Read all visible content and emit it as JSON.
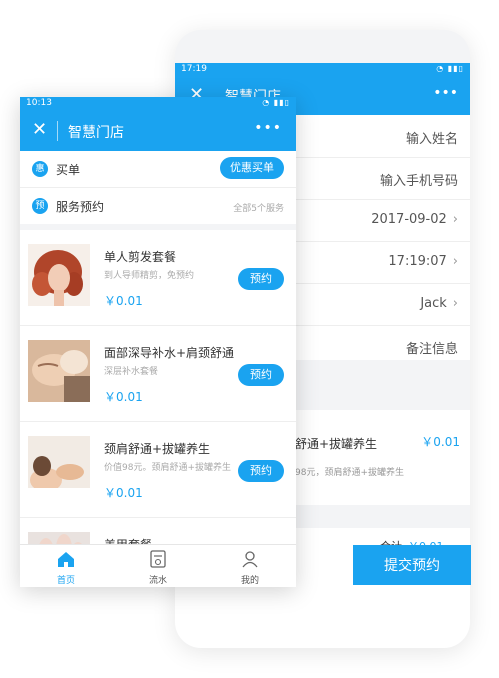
{
  "back_phone": {
    "time": "17:19",
    "title": "智慧门店",
    "form": {
      "name_placeholder": "输入姓名",
      "phone_placeholder": "输入手机号码",
      "date": "2017-09-02",
      "time": "17:19:07",
      "staff": "Jack",
      "note_placeholder": "备注信息"
    },
    "item": {
      "name": "舒通+拔罐养生",
      "desc": "98元，颈肩舒通+拔罐养生",
      "price": "￥0.01"
    },
    "total_label": "合计",
    "total_amount": "￥0.01",
    "submit_label": "提交预约"
  },
  "front_phone": {
    "time": "10:13",
    "title": "智慧门店",
    "buy": {
      "badge": "惠",
      "label": "买单",
      "button": "优惠买单"
    },
    "reserve": {
      "badge": "预",
      "label": "服务预约",
      "count": "全部5个服务"
    },
    "book_label": "预约",
    "services": [
      {
        "name": "单人剪发套餐",
        "desc": "到人导师精剪，免预约",
        "price": "￥0.01"
      },
      {
        "name": "面部深导补水+肩颈舒通",
        "desc": "深层补水套餐",
        "price": "￥0.01"
      },
      {
        "name": "颈肩舒通+拔罐养生",
        "desc": "价值98元。颈肩舒通+拔罐养生",
        "price": "￥0.01"
      },
      {
        "name": "美甲套餐",
        "desc": "",
        "price": ""
      }
    ],
    "tabs": [
      {
        "label": "首页",
        "icon": "home-icon"
      },
      {
        "label": "流水",
        "icon": "bill-icon"
      },
      {
        "label": "我的",
        "icon": "user-icon"
      }
    ]
  },
  "colors": {
    "accent": "#1aa3f0",
    "divider": "#f3f4f6"
  }
}
